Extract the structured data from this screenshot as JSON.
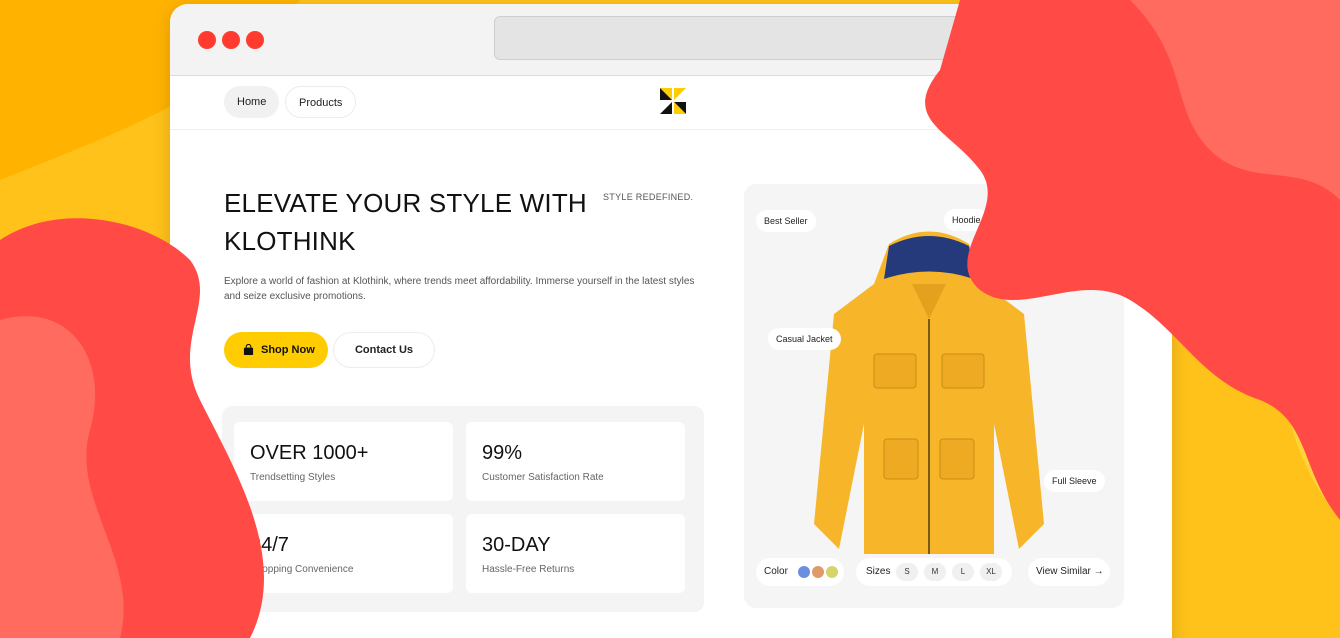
{
  "browser": {
    "window_dots": [
      "close",
      "minimize",
      "maximize"
    ],
    "url": ""
  },
  "nav": {
    "home": "Home",
    "products": "Products"
  },
  "hero": {
    "title_line1": "ELEVATE YOUR STYLE WITH",
    "title_line2": "KLOTHINK",
    "tagline": "STYLE REDEFINED.",
    "description": "Explore a world of fashion at Klothink, where trends meet affordability. Immerse yourself in the latest styles and seize exclusive promotions.",
    "shop_button": "Shop Now",
    "contact_button": "Contact Us"
  },
  "stats": [
    {
      "value": "OVER 1000+",
      "label": "Trendsetting Styles"
    },
    {
      "value": "99%",
      "label": "Customer Satisfaction Rate"
    },
    {
      "value": "24/7",
      "label": "Shopping Convenience"
    },
    {
      "value": "30-DAY",
      "label": "Hassle-Free Returns"
    }
  ],
  "product": {
    "badge": "Best Seller",
    "tags": {
      "hoodie": "Hoodie",
      "casual": "Casual Jacket",
      "sleeve": "Full Sleeve"
    },
    "color_label": "Color",
    "colors": [
      "#6b8fe0",
      "#e09a6a",
      "#d6d46a"
    ],
    "sizes_label": "Sizes",
    "sizes": [
      "S",
      "M",
      "L",
      "XL"
    ],
    "view_similar": "View Similar →"
  },
  "colors": {
    "accent": "#ffcc00",
    "background": "#ffc21a",
    "shapes": "#ff4a45"
  }
}
